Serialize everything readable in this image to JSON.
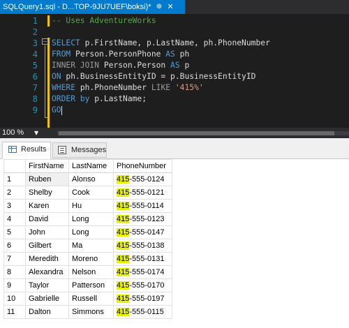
{
  "tab": {
    "title": "SQLQuery1.sql - D...TOP-9JU7UEF\\boksi)*",
    "pin_glyph": "⊕",
    "close_glyph": "✕"
  },
  "editor": {
    "line_numbers": [
      "1",
      "2",
      "3",
      "4",
      "5",
      "6",
      "7",
      "8",
      "9"
    ],
    "comment": "-- Uses AdventureWorks",
    "line3": {
      "kw": "SELECT",
      "cols": " p.FirstName, p.LastName, ph.PhoneNumber"
    },
    "line4": {
      "kw1": "FROM",
      "tbl": " Person.PersonPhone ",
      "kw2": "AS",
      "alias": " ph"
    },
    "line5": {
      "kw1": "INNER JOIN",
      "tbl": " Person.Person ",
      "kw2": "AS",
      "alias": " p"
    },
    "line6": {
      "kw": "ON",
      "expr": " ph.BusinessEntityID = p.BusinessEntityID"
    },
    "line7": {
      "kw": "WHERE",
      "col": " ph.PhoneNumber ",
      "op": "LIKE",
      "sp": " ",
      "str": "'415%'"
    },
    "line8": {
      "kw1": "ORDER",
      "kw2": " by",
      "expr": " p.LastName;"
    },
    "line9": {
      "kw": "GO"
    },
    "fold_glyph": "−"
  },
  "zoom": {
    "level": "100 %",
    "caret": "▼"
  },
  "results": {
    "tabs": [
      {
        "label": "Results"
      },
      {
        "label": "Messages"
      }
    ],
    "columns": [
      "FirstName",
      "LastName",
      "PhoneNumber"
    ],
    "highlight_prefix": "415",
    "rows": [
      {
        "n": "1",
        "first": "Ruben",
        "last": "Alonso",
        "phone_rest": "-555-0124"
      },
      {
        "n": "2",
        "first": "Shelby",
        "last": "Cook",
        "phone_rest": "-555-0121"
      },
      {
        "n": "3",
        "first": "Karen",
        "last": "Hu",
        "phone_rest": "-555-0114"
      },
      {
        "n": "4",
        "first": "David",
        "last": "Long",
        "phone_rest": "-555-0123"
      },
      {
        "n": "5",
        "first": "John",
        "last": "Long",
        "phone_rest": "-555-0147"
      },
      {
        "n": "6",
        "first": "Gilbert",
        "last": "Ma",
        "phone_rest": "-555-0138"
      },
      {
        "n": "7",
        "first": "Meredith",
        "last": "Moreno",
        "phone_rest": "-555-0131"
      },
      {
        "n": "8",
        "first": "Alexandra",
        "last": "Nelson",
        "phone_rest": "-555-0174"
      },
      {
        "n": "9",
        "first": "Taylor",
        "last": "Patterson",
        "phone_rest": "-555-0170"
      },
      {
        "n": "10",
        "first": "Gabrielle",
        "last": "Russell",
        "phone_rest": "-555-0197"
      },
      {
        "n": "11",
        "first": "Dalton",
        "last": "Simmons",
        "phone_rest": "-555-0115"
      }
    ]
  },
  "colors": {
    "accent": "#007acc",
    "keyword": "#569cd6",
    "comment": "#57a64a",
    "string": "#d69d85",
    "highlight": "#e7f200"
  }
}
